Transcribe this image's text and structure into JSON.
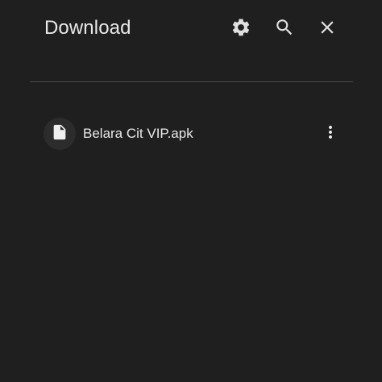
{
  "header": {
    "title": "Download",
    "icons": {
      "settings": "gear-icon",
      "search": "search-icon",
      "close": "close-icon"
    }
  },
  "downloads": [
    {
      "file_name": "Belara Cit VIP.apk",
      "icon": "file-icon",
      "menu_icon": "more-vertical-icon"
    }
  ],
  "colors": {
    "background": "#1f1f1f",
    "text": "#e8e8e8",
    "icon": "#e0e0e0",
    "divider": "#4a4a4a",
    "file_icon_bg": "#2c2c2c"
  }
}
